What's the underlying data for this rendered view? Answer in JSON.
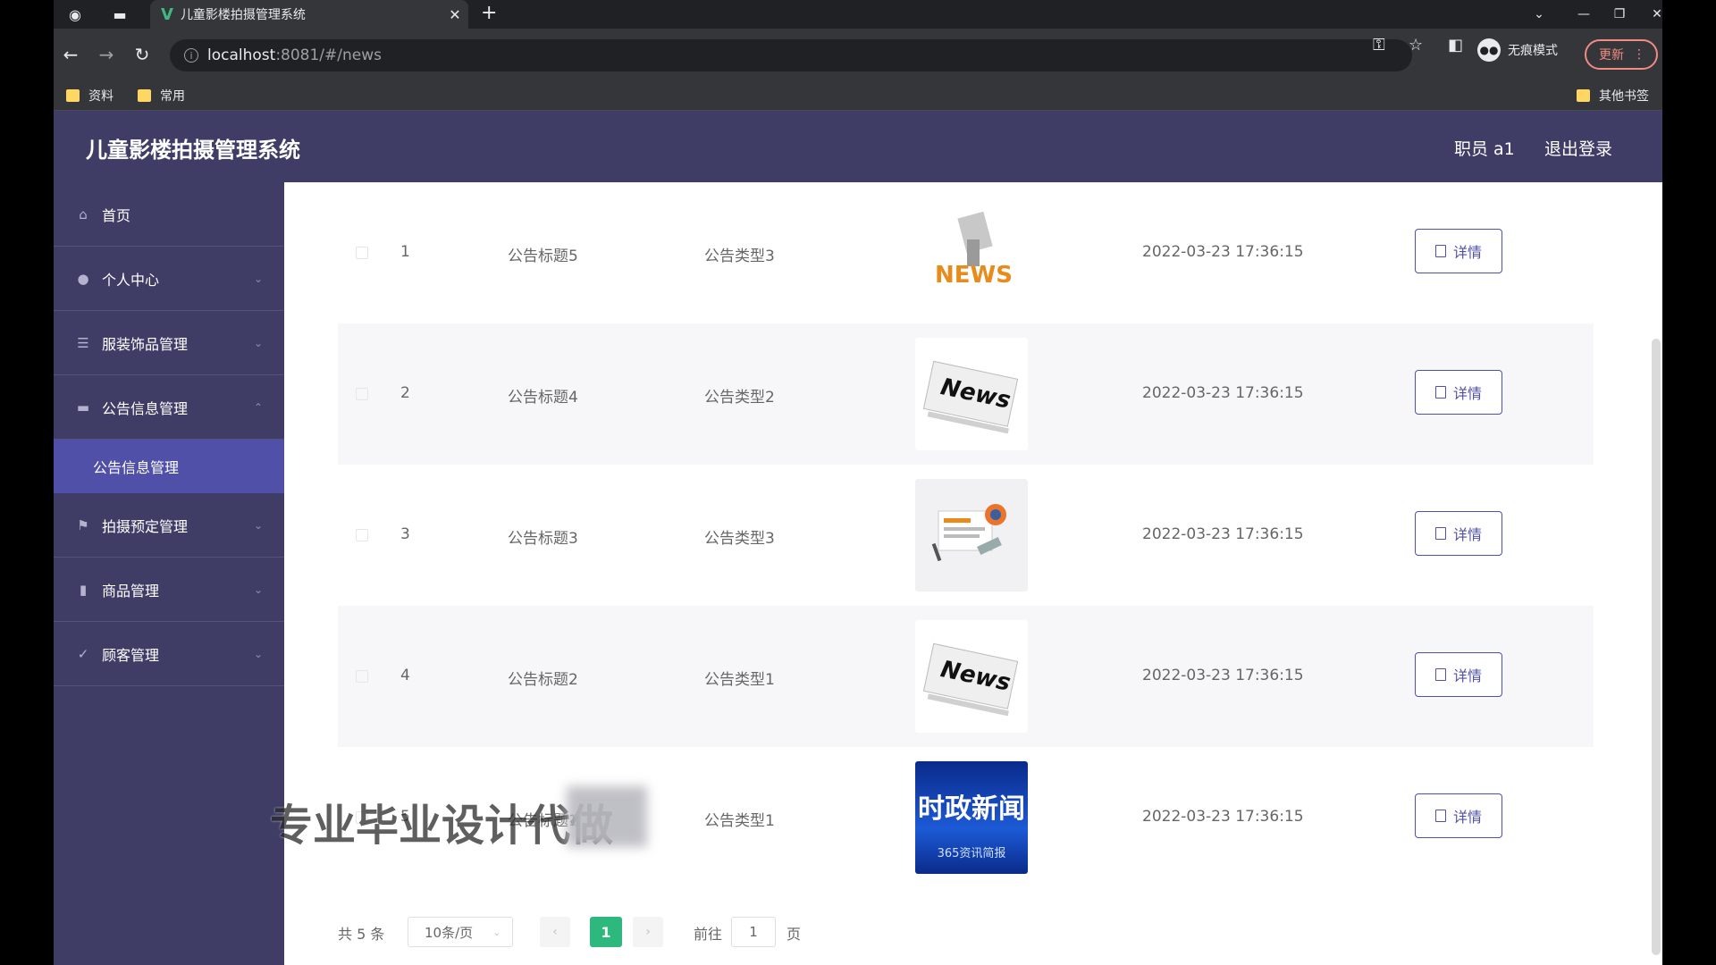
{
  "browser": {
    "tab_title": "儿童影楼拍摄管理系统",
    "url_host": "localhost",
    "url_rest": ":8081/#/news",
    "incognito_label": "无痕模式",
    "update_label": "更新",
    "bookmarks": [
      "资料",
      "常用"
    ],
    "other_bookmarks": "其他书签"
  },
  "header": {
    "title": "儿童影楼拍摄管理系统",
    "user": "职员 a1",
    "logout": "退出登录"
  },
  "sidebar": {
    "items": [
      {
        "label": "首页",
        "icon": "home-icon"
      },
      {
        "label": "个人中心",
        "icon": "user-icon"
      },
      {
        "label": "服装饰品管理",
        "icon": "list-icon"
      },
      {
        "label": "公告信息管理",
        "icon": "briefcase-icon"
      },
      {
        "label": "拍摄预定管理",
        "icon": "flag-icon"
      },
      {
        "label": "商品管理",
        "icon": "film-icon"
      },
      {
        "label": "顾客管理",
        "icon": "check-circle-icon"
      }
    ],
    "active_sub": "公告信息管理"
  },
  "table": {
    "rows": [
      {
        "index": "1",
        "title": "公告标题5",
        "type": "公告类型3",
        "time": "2022-03-23 17:36:15",
        "action": "详情",
        "image": "news-3d-icon"
      },
      {
        "index": "2",
        "title": "公告标题4",
        "type": "公告类型2",
        "time": "2022-03-23 17:36:15",
        "action": "详情",
        "image": "newspaper-icon"
      },
      {
        "index": "3",
        "title": "公告标题3",
        "type": "公告类型3",
        "time": "2022-03-23 17:36:15",
        "action": "详情",
        "image": "news-board-icon"
      },
      {
        "index": "4",
        "title": "公告标题2",
        "type": "公告类型1",
        "time": "2022-03-23 17:36:15",
        "action": "详情",
        "image": "newspaper-icon"
      },
      {
        "index": "5",
        "title": "公告标题1",
        "type": "公告类型1",
        "time": "2022-03-23 17:36:15",
        "action": "详情",
        "image": "political-news-banner",
        "image_text": "时政新闻",
        "image_subtext": "365资讯简报"
      }
    ]
  },
  "pagination": {
    "total": "共 5 条",
    "page_size": "10条/页",
    "current_page": "1",
    "goto_label": "前往",
    "goto_value": "1",
    "goto_suffix": "页"
  },
  "overlay": {
    "watermark": "专业毕业设计代做"
  },
  "colors": {
    "header_bg": "#3f3d66",
    "active_sub_bg": "#5150a8",
    "page_active": "#2db87d",
    "button_accent": "#5150a8"
  }
}
